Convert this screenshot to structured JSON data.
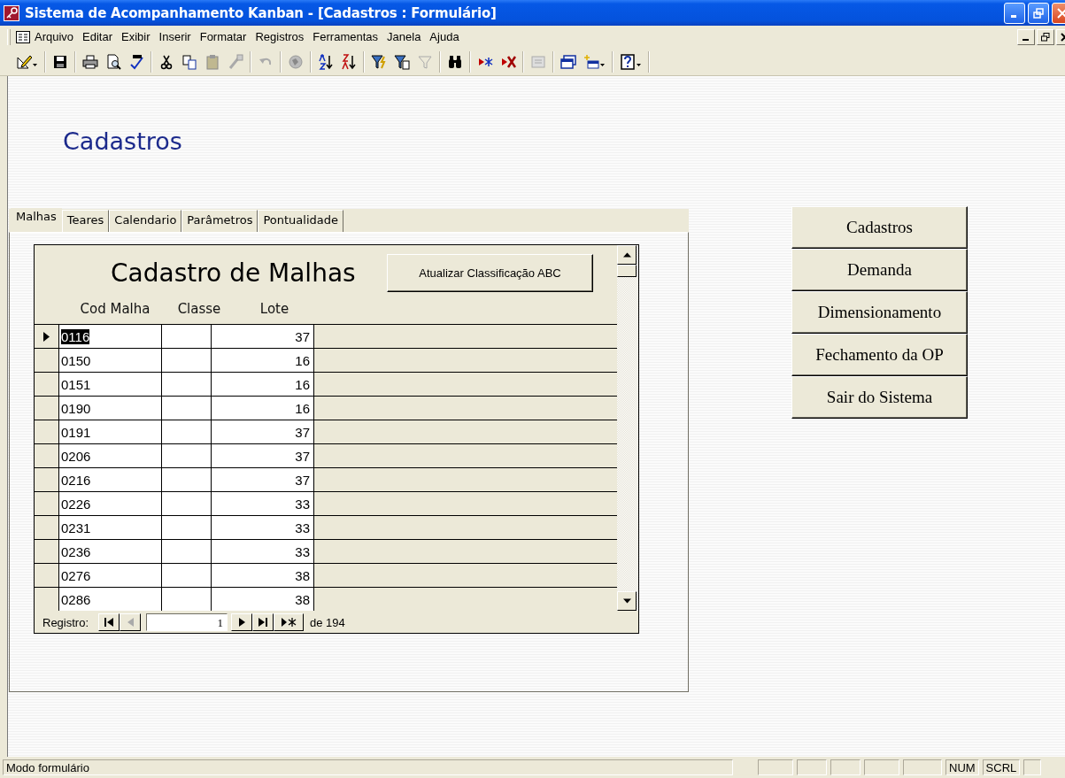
{
  "window": {
    "title": "Sistema de Acompanhamento Kanban - [Cadastros : Formulário]"
  },
  "menu": [
    "Arquivo",
    "Editar",
    "Exibir",
    "Inserir",
    "Formatar",
    "Registros",
    "Ferramentas",
    "Janela",
    "Ajuda"
  ],
  "form": {
    "heading": "Cadastros",
    "tabs": [
      {
        "label": "Malhas",
        "selected": true
      },
      {
        "label": "Teares",
        "selected": false
      },
      {
        "label": "Calendario",
        "selected": false
      },
      {
        "label": "Parâmetros",
        "selected": false
      },
      {
        "label": "Pontualidade",
        "selected": false
      }
    ],
    "subform": {
      "title": "Cadastro de Malhas",
      "action_button": "Atualizar Classificação ABC",
      "columns": [
        "Cod Malha",
        "Classe",
        "Lote"
      ],
      "rows": [
        {
          "cod": "0116",
          "lote": "37",
          "selected": true
        },
        {
          "cod": "0150",
          "lote": "16",
          "selected": false
        },
        {
          "cod": "0151",
          "lote": "16",
          "selected": false
        },
        {
          "cod": "0190",
          "lote": "16",
          "selected": false
        },
        {
          "cod": "0191",
          "lote": "37",
          "selected": false
        },
        {
          "cod": "0206",
          "lote": "37",
          "selected": false
        },
        {
          "cod": "0216",
          "lote": "37",
          "selected": false
        },
        {
          "cod": "0226",
          "lote": "33",
          "selected": false
        },
        {
          "cod": "0231",
          "lote": "33",
          "selected": false
        },
        {
          "cod": "0236",
          "lote": "33",
          "selected": false
        },
        {
          "cod": "0276",
          "lote": "38",
          "selected": false
        },
        {
          "cod": "0286",
          "lote": "38",
          "selected": false
        }
      ]
    },
    "navigator": {
      "label": "Registro:",
      "current": "1",
      "total": "de 194",
      "buttons": [
        {
          "kind": "first",
          "disabled": false
        },
        {
          "kind": "prev",
          "disabled": true
        },
        {
          "kind": "next",
          "disabled": false
        },
        {
          "kind": "last",
          "disabled": false
        },
        {
          "kind": "new",
          "disabled": false
        }
      ]
    },
    "menu_buttons": [
      "Cadastros",
      "Demanda",
      "Dimensionamento",
      "Fechamento da OP",
      "Sair do Sistema"
    ]
  },
  "status_bar": {
    "text": "Modo formulário",
    "indicators": [
      "NUM",
      "SCRL"
    ]
  }
}
